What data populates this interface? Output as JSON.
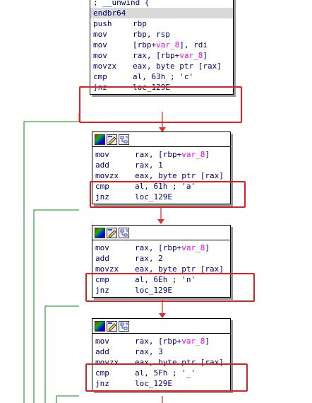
{
  "colors": {
    "normal_edge": "#3aa84a",
    "branch_edge": "#e03030",
    "highlight_box": "#e02020",
    "mnemonic": "#000080",
    "symbol": "#ff00ff"
  },
  "toolbar_icons": [
    "node-color-icon",
    "rename-node-icon",
    "group-nodes-icon"
  ],
  "blocks": [
    {
      "id": "entry",
      "lines": [
        {
          "text": "; __unwind {"
        },
        {
          "mnemonic": "endbr64",
          "ops": "",
          "highlighted": true
        },
        {
          "mnemonic": "push",
          "ops": "rbp"
        },
        {
          "mnemonic": "mov",
          "ops": "rbp, rsp"
        },
        {
          "mnemonic": "mov",
          "ops_pre": "[rbp+",
          "sym": "var_8",
          "ops_post": "], rdi"
        },
        {
          "mnemonic": "mov",
          "ops_pre": "rax, [rbp+",
          "sym": "var_8",
          "ops_post": "]"
        },
        {
          "mnemonic": "movzx",
          "ops": "eax, byte ptr [rax]"
        },
        {
          "mnemonic": "cmp",
          "ops": "al, 63h",
          "comment": " ; 'c'"
        },
        {
          "mnemonic": "jnz",
          "ops": "loc_129E"
        }
      ]
    },
    {
      "id": "check_a",
      "lines": [
        {
          "mnemonic": "mov",
          "ops_pre": "rax, [rbp+",
          "sym": "var_8",
          "ops_post": "]"
        },
        {
          "mnemonic": "add",
          "ops": "rax, 1"
        },
        {
          "mnemonic": "movzx",
          "ops": "eax, byte ptr [rax]"
        },
        {
          "mnemonic": "cmp",
          "ops": "al, 61h",
          "comment": " ; 'a'"
        },
        {
          "mnemonic": "jnz",
          "ops": "loc_129E"
        }
      ]
    },
    {
      "id": "check_n",
      "lines": [
        {
          "mnemonic": "mov",
          "ops_pre": "rax, [rbp+",
          "sym": "var_8",
          "ops_post": "]"
        },
        {
          "mnemonic": "add",
          "ops": "rax, 2"
        },
        {
          "mnemonic": "movzx",
          "ops": "eax, byte ptr [rax]"
        },
        {
          "mnemonic": "cmp",
          "ops": "al, 6Eh",
          "comment": " ; 'n'"
        },
        {
          "mnemonic": "jnz",
          "ops": "loc_129E"
        }
      ]
    },
    {
      "id": "check_underscore",
      "lines": [
        {
          "mnemonic": "mov",
          "ops_pre": "rax, [rbp+",
          "sym": "var_8",
          "ops_post": "]"
        },
        {
          "mnemonic": "add",
          "ops": "rax, 3"
        },
        {
          "mnemonic": "movzx",
          "ops": "eax, byte ptr [rax]"
        },
        {
          "mnemonic": "cmp",
          "ops": "al, 5Fh",
          "comment": " ; '_'"
        },
        {
          "mnemonic": "jnz",
          "ops": "loc_129E"
        }
      ]
    }
  ]
}
